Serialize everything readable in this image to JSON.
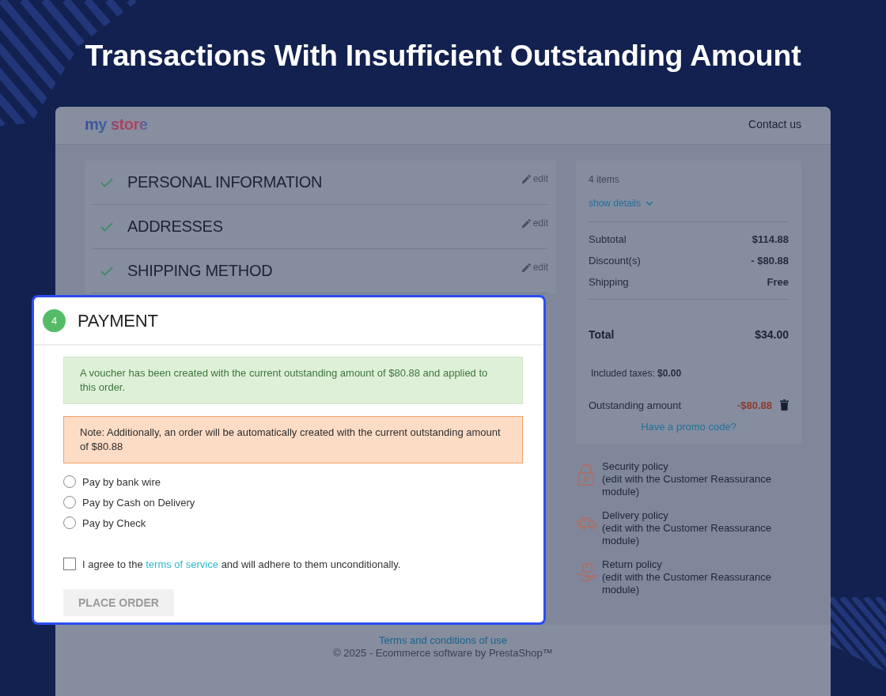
{
  "title": "Transactions With Insufficient Outstanding Amount",
  "header": {
    "logo": "my store",
    "contact_link": "Contact us"
  },
  "checkout_steps": [
    {
      "title": "PERSONAL INFORMATION",
      "completed": true,
      "edit_link": "edit"
    },
    {
      "title": "ADDRESSES",
      "completed": true,
      "edit_link": "edit"
    },
    {
      "title": "SHIPPING METHOD",
      "completed": true,
      "edit_link": "edit"
    }
  ],
  "payment_step": {
    "number": "4",
    "title": "PAYMENT",
    "messages": [
      {
        "kind": "success",
        "text": "A voucher has been created with the current outstanding amount of $80.88 and applied to this order."
      },
      {
        "kind": "warning",
        "text": "Note: Additionally, an order will be automatically created with the current outstanding amount of $80.88"
      }
    ],
    "options": [
      {
        "label": "Pay by bank wire",
        "selected": false
      },
      {
        "label": "Pay by Cash on Delivery",
        "selected": false
      },
      {
        "label": "Pay by Check",
        "selected": false
      }
    ],
    "terms": {
      "text_before": "I agree to the",
      "link": "terms of service",
      "text_after": "and will adhere to them unconditionally.",
      "checked": false
    },
    "place_order_button": {
      "label": "PLACE ORDER",
      "disabled": true
    }
  },
  "summary": {
    "items_count": "4 items",
    "details_link": "show details",
    "lines": [
      {
        "label": "Subtotal",
        "value": "$114.88"
      },
      {
        "label": "Discount(s)",
        "value": "- $80.88"
      },
      {
        "label": "Shipping",
        "value": "Free"
      }
    ],
    "total": {
      "label": "Total",
      "value": "$34.00"
    },
    "taxes": "Included taxes: **$0.00**",
    "outstanding": {
      "label": "Outstanding amount",
      "value": "-$80.88"
    },
    "promo_link": "Have a promo code?"
  },
  "reassurance": [
    {
      "kind": "security",
      "title": "Security policy",
      "description": "(edit with the Customer Reassurance module)"
    },
    {
      "kind": "delivery",
      "title": "Delivery policy",
      "description": "(edit with the Customer Reassurance module)"
    },
    {
      "kind": "return",
      "title": "Return policy",
      "description": "(edit with the Customer Reassurance module)"
    }
  ],
  "footer": {
    "link": "Terms and conditions of use",
    "copyright": "© 2025 - Ecommerce software by PrestaShop™"
  }
}
